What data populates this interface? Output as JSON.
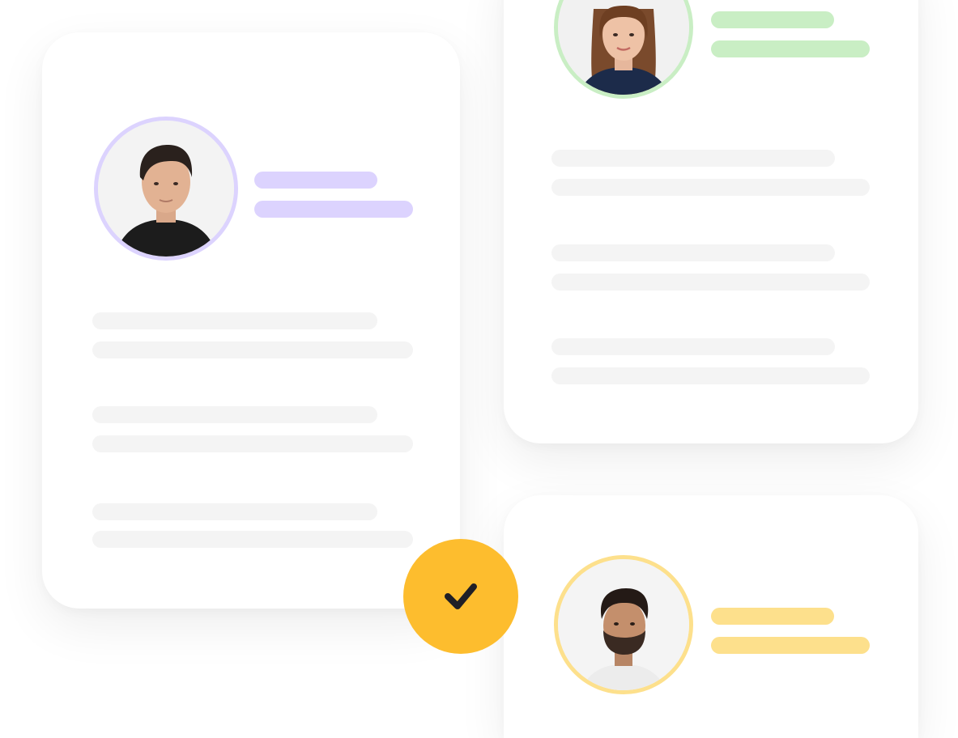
{
  "colors": {
    "purple_accent": "#dcd3fe",
    "green_accent": "#c9eec4",
    "yellow_accent": "#fde08c",
    "badge_yellow": "#fdbd2e",
    "check_mark": "#1f1f26",
    "placeholder_line": "#f4f4f4"
  },
  "cards": [
    {
      "id": "left",
      "avatar": {
        "icon": "man-portrait-icon",
        "ring": "purple"
      }
    },
    {
      "id": "right",
      "avatar": {
        "icon": "woman-portrait-icon",
        "ring": "green"
      }
    },
    {
      "id": "bottom",
      "avatar": {
        "icon": "bearded-man-portrait-icon",
        "ring": "yellow"
      }
    }
  ],
  "badge": {
    "icon": "checkmark-icon"
  }
}
